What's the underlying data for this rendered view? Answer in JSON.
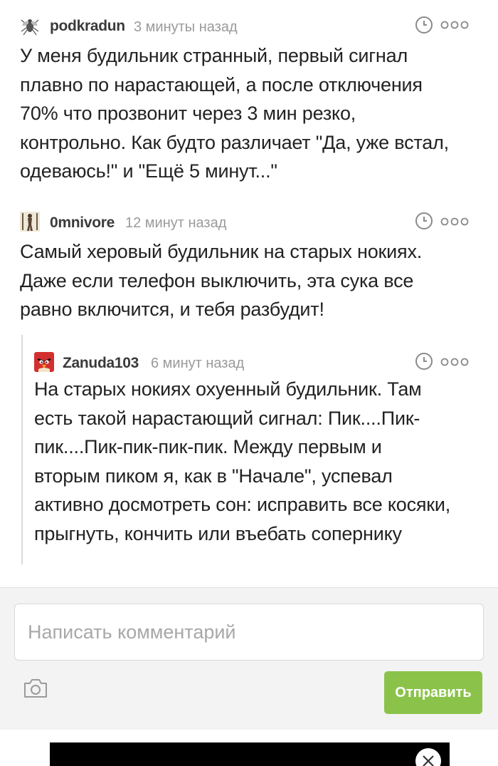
{
  "comments": [
    {
      "username": "podkradun",
      "time": "3 минуты назад",
      "avatar": "fly-avatar",
      "lines": [
        "У меня будильник странный, первый сигнал",
        "плавно по нарастающей, а после отключения",
        "70% что прозвонит через 3 мин резко,",
        "контрольно. Как будто различает \"Да, уже встал,",
        "одеваюсь!\" и \"Ещё 5 минут...\""
      ]
    },
    {
      "username": "0mnivore",
      "time": "12 минут назад",
      "avatar": "figure-avatar",
      "lines": [
        "Самый херовый будильник на старых нокиях.",
        "Даже если телефон выключить, эта сука все",
        "равно включится, и тебя разбудит!"
      ]
    },
    {
      "username": "Zanuda103",
      "time": "6 минут назад",
      "avatar": "angry-bird-avatar",
      "lines": [
        "На старых нокиях охуенный будильник. Там",
        "есть такой нарастающий сигнал: Пик....Пик-",
        "пик....Пик-пик-пик-пик. Между первым и",
        "вторым пиком я, как в \"Начале\", успевал",
        "активно досмотреть сон: исправить все косяки,",
        "прыгнуть, кончить или въебать сопернику"
      ]
    }
  ],
  "footer": {
    "placeholder": "Написать комментарий",
    "send_label": "Отправить",
    "camera_icon": "camera-icon"
  },
  "colors": {
    "send_button": "#8bc34a",
    "username": "#3a3a3a",
    "timeago": "#9a9a9a",
    "icons": "#8a8a8a"
  }
}
